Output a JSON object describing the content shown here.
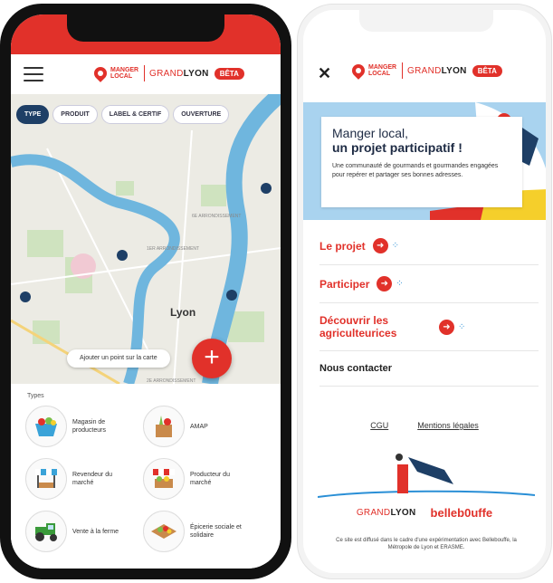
{
  "map_screen": {
    "brand": {
      "name": "MANGER LOCAL",
      "partner_prefix": "GRAND",
      "partner_suffix": "LYON",
      "badge": "BÊTA"
    },
    "filters": [
      "TYPE",
      "PRODUIT",
      "LABEL & CERTIF",
      "OUVERTURE"
    ],
    "city_label": "Lyon",
    "add_point_tooltip": "Ajouter un point sur la carte",
    "add_point_button": "+",
    "sheet_title": "Types",
    "types": [
      {
        "label": "Magasin de producteurs",
        "icon": "basket-icon"
      },
      {
        "label": "AMAP",
        "icon": "vegetable-box-icon"
      },
      {
        "label": "Revendeur du marché",
        "icon": "market-stall-icon"
      },
      {
        "label": "Producteur du marché",
        "icon": "produce-stall-icon"
      },
      {
        "label": "Vente à la ferme",
        "icon": "tractor-icon"
      },
      {
        "label": "Épicerie sociale et solidaire",
        "icon": "grocery-crate-icon"
      }
    ]
  },
  "menu_screen": {
    "close_label": "✕",
    "brand": {
      "name": "MANGER LOCAL",
      "partner_prefix": "GRAND",
      "partner_suffix": "LYON",
      "badge": "BÊTA"
    },
    "hero": {
      "title_line1": "Manger local,",
      "title_line2": "un projet participatif !",
      "subtitle": "Une communauté de gourmands et gourmandes engagées pour repérer et partager ses bonnes adresses."
    },
    "menu_items": [
      "Le projet",
      "Participer",
      "Découvrir les agriculteurices"
    ],
    "contact_label": "Nous contacter",
    "links": [
      "CGU",
      "Mentions légales"
    ],
    "partners": {
      "grandlyon_prefix": "GRAND",
      "grandlyon_suffix": "LYON",
      "bellebouffe": "belleb0uffe"
    },
    "footer": "Ce site est diffusé dans le cadre d'une expérimentation avec Bellebouffe, la Métropole de Lyon et ERASME."
  },
  "colors": {
    "brand_red": "#e1312a",
    "chip_active": "#1e3f66",
    "river_blue": "#6fb6de",
    "hero_blue": "#a9d3ef",
    "accent_yellow": "#f5cf2b"
  }
}
